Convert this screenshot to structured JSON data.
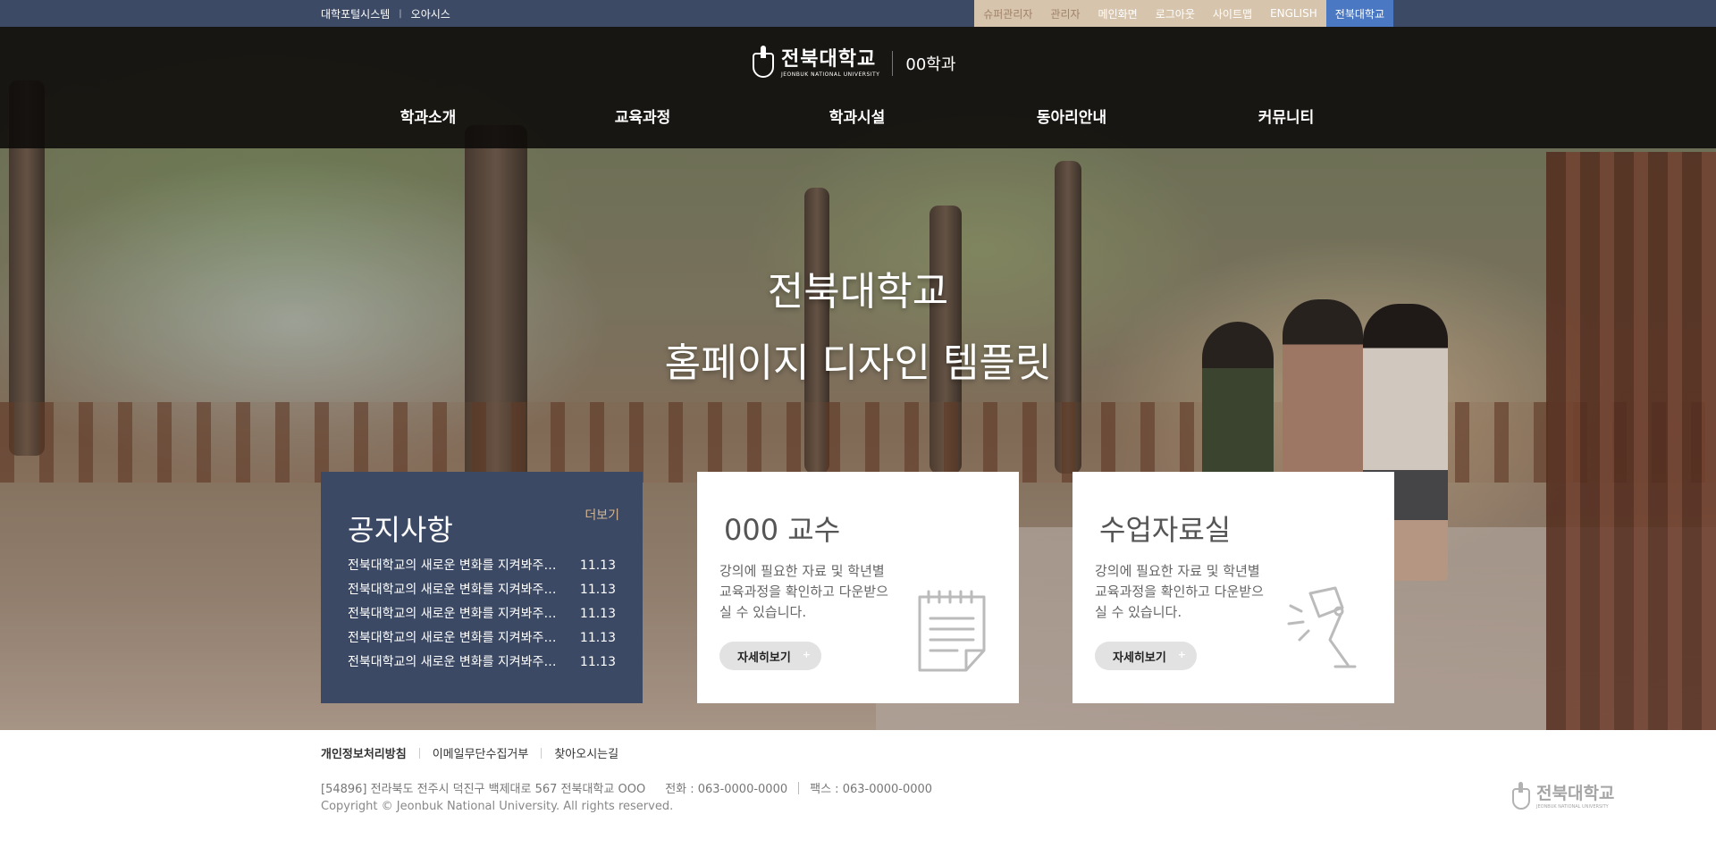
{
  "topbar": {
    "portal_links": [
      "대학포털시스템",
      "오아시스"
    ],
    "util_links": [
      "슈퍼관리자",
      "관리자",
      "메인화면",
      "로그아웃",
      "사이트맵",
      "ENGLISH",
      "전북대학교"
    ]
  },
  "header": {
    "logo_ko": "전북대학교",
    "logo_en": "JEONBUK NATIONAL UNIVERSITY",
    "dept_name": "00학과",
    "nav": [
      "학과소개",
      "교육과정",
      "학과시설",
      "동아리안내",
      "커뮤니티"
    ]
  },
  "hero": {
    "title_line1": "전북대학교",
    "title_line2": "홈페이지 디자인 템플릿"
  },
  "notice": {
    "title": "공지사항",
    "more_label": "더보기",
    "items": [
      {
        "title": "전북대학교의 새로운 변화를 지켜봐주시기 바랍니다",
        "date": "11.13"
      },
      {
        "title": "전북대학교의 새로운 변화를 지켜봐주시기 바랍니다",
        "date": "11.13"
      },
      {
        "title": "전북대학교의 새로운 변화를 지켜봐주시기 바랍니다",
        "date": "11.13"
      },
      {
        "title": "전북대학교의 새로운 변화를 지켜봐주시기 바랍니다",
        "date": "11.13"
      },
      {
        "title": "전북대학교의 새로운 변화를 지켜봐주시기 바랍니다",
        "date": "11.13"
      }
    ]
  },
  "professor_card": {
    "title": "000 교수",
    "desc": "강의에 필요한 자료 및 학년별 교육과정을 확인하고 다운받으실 수 있습니다.",
    "button_label": "자세히보기",
    "icon": "notepad-icon"
  },
  "materials_card": {
    "title": "수업자료실",
    "desc": "강의에 필요한 자료 및 학년별 교육과정을 확인하고 다운받으실 수 있습니다.",
    "button_label": "자세히보기",
    "icon": "desk-lamp-icon"
  },
  "footer": {
    "links": [
      "개인정보처리방침",
      "이메일무단수집거부",
      "찾아오시는길"
    ],
    "address": "[54896] 전라북도 전주시 덕진구 백제대로 567 전북대학교 OOO",
    "phone": "전화 : 063-0000-0000",
    "fax": "팩스 : 063-0000-0000",
    "copyright": "Copyright © Jeonbuk National University. All rights reserved.",
    "logo_ko": "전북대학교",
    "logo_en": "JEONBUK NATIONAL UNIVERSITY"
  },
  "colors": {
    "navy": "#3b4965",
    "topbar": "#3c4a66",
    "util_bg": "#d7c4ad",
    "accent_gold": "#d6b58e",
    "brand_blue": "#4a78c2"
  }
}
